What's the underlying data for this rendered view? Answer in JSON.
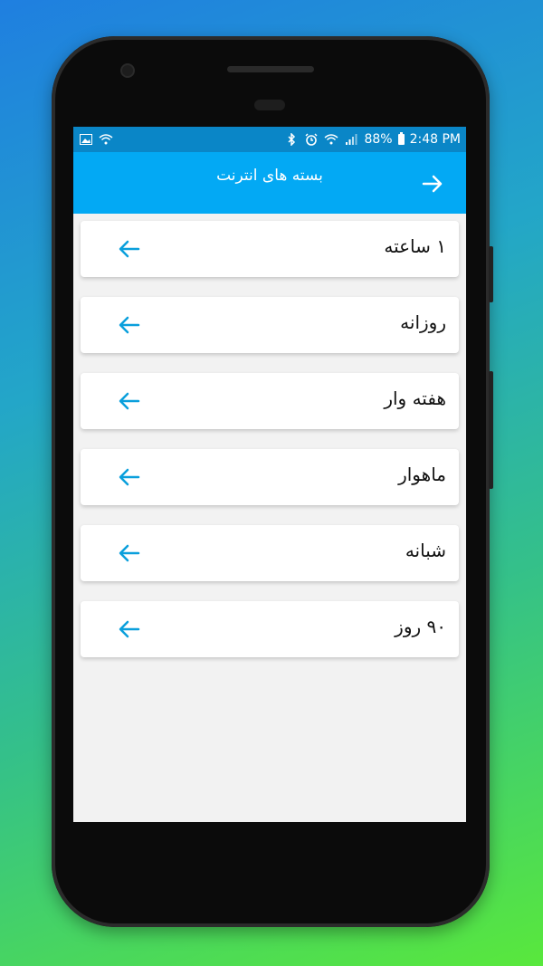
{
  "status_bar": {
    "battery": "88%",
    "time": "2:48 PM",
    "left_icons": [
      "image-icon",
      "wifi-icon"
    ],
    "right_icons": [
      "bluetooth-icon",
      "alarm-icon",
      "wifi-icon",
      "signal-icon",
      "battery-icon"
    ]
  },
  "appbar": {
    "title": "بسته های انترنت",
    "back_icon": "arrow-right-icon"
  },
  "list": {
    "items": [
      {
        "label": "۱ ساعته",
        "icon": "arrow-left-icon"
      },
      {
        "label": "روزانه",
        "icon": "arrow-left-icon"
      },
      {
        "label": "هفته وار",
        "icon": "arrow-left-icon"
      },
      {
        "label": "ماهوار",
        "icon": "arrow-left-icon"
      },
      {
        "label": "شبانه",
        "icon": "arrow-left-icon"
      },
      {
        "label": "۹۰ روز",
        "icon": "arrow-left-icon"
      }
    ]
  },
  "colors": {
    "appbar": "#03a9f4",
    "statusbar": "#0a86c7",
    "arrow": "#0a9fdc",
    "background": "#f2f2f2"
  }
}
